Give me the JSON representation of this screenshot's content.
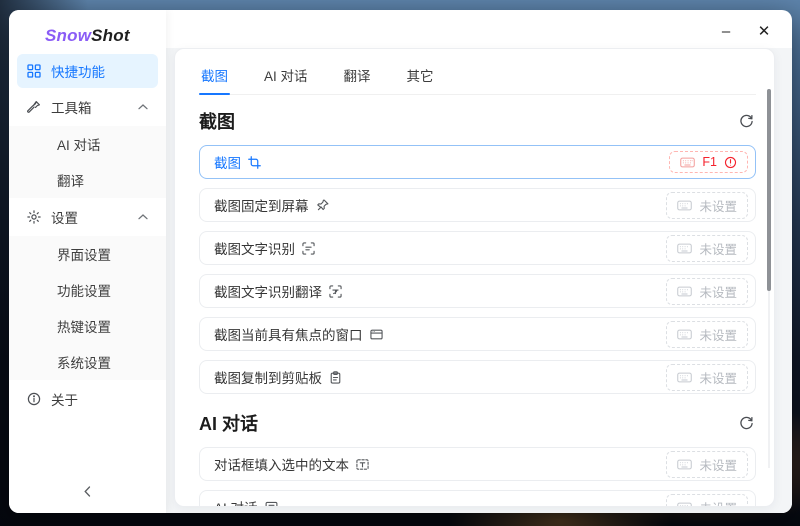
{
  "window": {
    "controls": {
      "minimize": "–",
      "close": "✕"
    }
  },
  "logo": {
    "part1": "Snow",
    "part2": "Shot"
  },
  "sidebar": {
    "items": [
      {
        "label": "快捷功能",
        "icon": "grid-icon",
        "selected": true
      },
      {
        "label": "工具箱",
        "icon": "tool-icon",
        "expanded": true
      },
      {
        "label": "AI 对话",
        "child": true
      },
      {
        "label": "翻译",
        "child": true
      },
      {
        "label": "设置",
        "icon": "gear-icon",
        "expanded": true
      },
      {
        "label": "界面设置",
        "child": true
      },
      {
        "label": "功能设置",
        "child": true
      },
      {
        "label": "热键设置",
        "child": true
      },
      {
        "label": "系统设置",
        "child": true
      },
      {
        "label": "关于",
        "icon": "info-icon"
      }
    ]
  },
  "tabs": [
    {
      "label": "截图",
      "active": true
    },
    {
      "label": "AI 对话"
    },
    {
      "label": "翻译"
    },
    {
      "label": "其它"
    }
  ],
  "labels": {
    "unset": "未设置"
  },
  "sections": [
    {
      "title": "截图",
      "rows": [
        {
          "label": "截图",
          "icon": "screenshot-icon",
          "hotkey": "F1",
          "highlighted": true,
          "conflict": true
        },
        {
          "label": "截图固定到屏幕",
          "icon": "pin-icon"
        },
        {
          "label": "截图文字识别",
          "icon": "ocr-icon"
        },
        {
          "label": "截图文字识别翻译",
          "icon": "ocr-translate-icon"
        },
        {
          "label": "截图当前具有焦点的窗口",
          "icon": "window-icon"
        },
        {
          "label": "截图复制到剪贴板",
          "icon": "clipboard-icon"
        }
      ]
    },
    {
      "title": "AI 对话",
      "rows": [
        {
          "label": "对话框填入选中的文本",
          "icon": "text-select-icon"
        },
        {
          "label": "AI 对话",
          "icon": "chat-icon"
        }
      ]
    }
  ],
  "colors": {
    "accent": "#1677ff",
    "accent_bg": "#e6f4ff",
    "danger": "#f5222d",
    "danger_border": "#ffb6b2"
  }
}
